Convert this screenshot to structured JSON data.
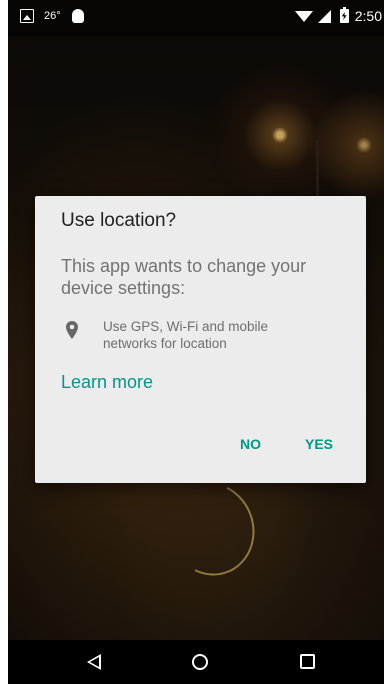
{
  "status_bar": {
    "temperature": "26°",
    "time": "2:50"
  },
  "dialog": {
    "title": "Use location?",
    "message": "This app wants to change your device settings:",
    "permission_text": "Use GPS, Wi-Fi and mobile networks for location",
    "permission_icon": "location-pin-icon",
    "learn_more": "Learn more",
    "no_label": "NO",
    "yes_label": "YES"
  },
  "colors": {
    "accent": "#009688",
    "dialog_background": "#ececec",
    "title_text": "#212121",
    "body_text": "#737373"
  }
}
